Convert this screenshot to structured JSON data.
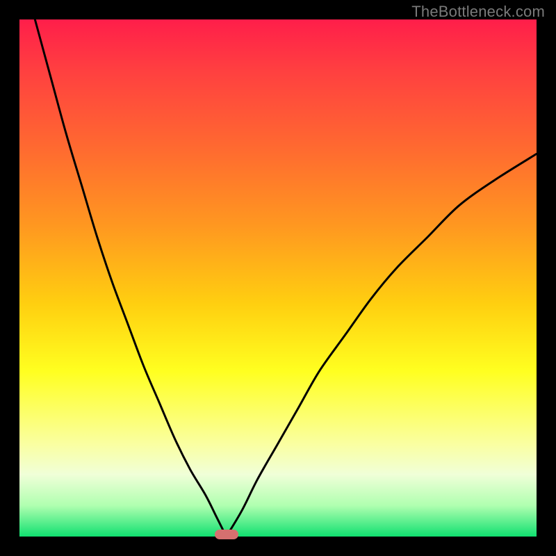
{
  "watermark": "TheBottleneck.com",
  "colors": {
    "frame": "#000000",
    "gradient_top": "#ff1e4a",
    "gradient_bottom": "#10e070",
    "curve": "#000000",
    "marker": "#d6706f"
  },
  "chart_data": {
    "type": "line",
    "title": "",
    "xlabel": "",
    "ylabel": "",
    "xlim": [
      0,
      100
    ],
    "ylim": [
      0,
      100
    ],
    "annotations": [
      {
        "name": "marker-pill",
        "x": 40,
        "y": 0
      }
    ],
    "series": [
      {
        "name": "left-branch",
        "x": [
          3,
          6,
          9,
          12,
          15,
          18,
          21,
          24,
          27,
          30,
          33,
          36,
          38,
          40
        ],
        "y": [
          100,
          89,
          78,
          68,
          58,
          49,
          41,
          33,
          26,
          19,
          13,
          8,
          4,
          0
        ]
      },
      {
        "name": "right-branch",
        "x": [
          40,
          43,
          46,
          50,
          54,
          58,
          63,
          68,
          73,
          79,
          85,
          92,
          100
        ],
        "y": [
          0,
          5,
          11,
          18,
          25,
          32,
          39,
          46,
          52,
          58,
          64,
          69,
          74
        ]
      }
    ]
  }
}
